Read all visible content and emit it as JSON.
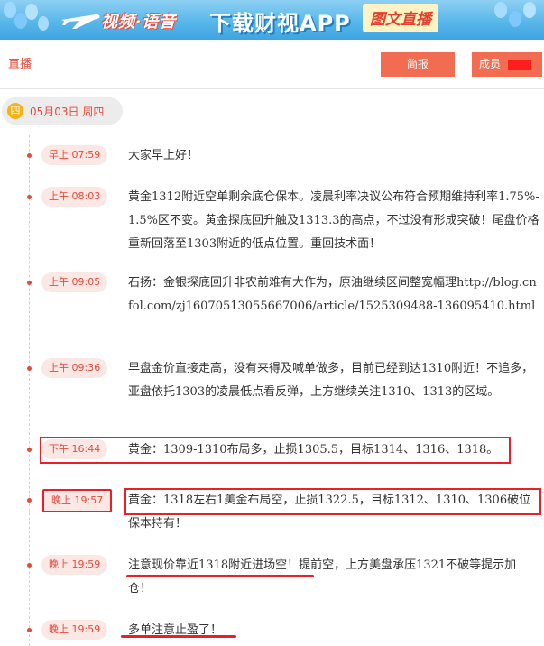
{
  "banner": {
    "slogan": "视频·语音",
    "download": "下载财视APP",
    "live_text": "图文直播",
    "colors": {
      "sky": "#58b7ea",
      "accent": "#e8493b",
      "label_bg": "#fff3c4"
    },
    "icons": [
      "airplane-icon",
      "balloon-icon"
    ]
  },
  "header": {
    "live_label": "直播",
    "brief_button": "简报",
    "member_button": "成员"
  },
  "date": {
    "badge": "四",
    "text": "05月03日 周四"
  },
  "entries": [
    {
      "time": "早上 07:59",
      "text": "大家早上好！"
    },
    {
      "time": "上午 08:03",
      "text": "黄金1312附近空单剩余底仓保本。凌晨利率决议公布符合预期维持利率1.75%-1.5%区不变。黄金探底回升触及1313.3的高点，不过没有形成突破！尾盘价格重新回落至1303附近的低点位置。重回技术面！"
    },
    {
      "time": "上午 09:05",
      "text": "石扬：金银探底回升非农前难有大作为，原油继续区间整宽幅理http://blog.cnfol.com/zj16070513055667006/article/1525309488-136095410.html"
    },
    {
      "time": "上午 09:36",
      "text": "早盘金价直接走高，没有来得及喊单做多，目前已经到达1310附近！不追多，亚盘依托1303的凌晨低点看反弹，上方继续关注1310、1313的区域。"
    },
    {
      "time": "下午 16:44",
      "text": "黄金：1309-1310布局多，止损1305.5，目标1314、1316、1318。"
    },
    {
      "time": "晚上 19:57",
      "text": "黄金：1318左右1美金布局空，止损1322.5，目标1312、1310、1306破位保本持有！"
    },
    {
      "time": "晚上 19:59",
      "text": "注意现价靠近1318附近进场空！提前空，上方美盘承压1321不破等提示加仓！"
    },
    {
      "time": "晚上 19:59",
      "text": "多单注意止盈了！"
    }
  ],
  "colors": {
    "brand_red": "#e8493b",
    "button": "#f26c52",
    "annotation_red": "#e8202a",
    "time_tag_bg": "#fbe8e4"
  }
}
